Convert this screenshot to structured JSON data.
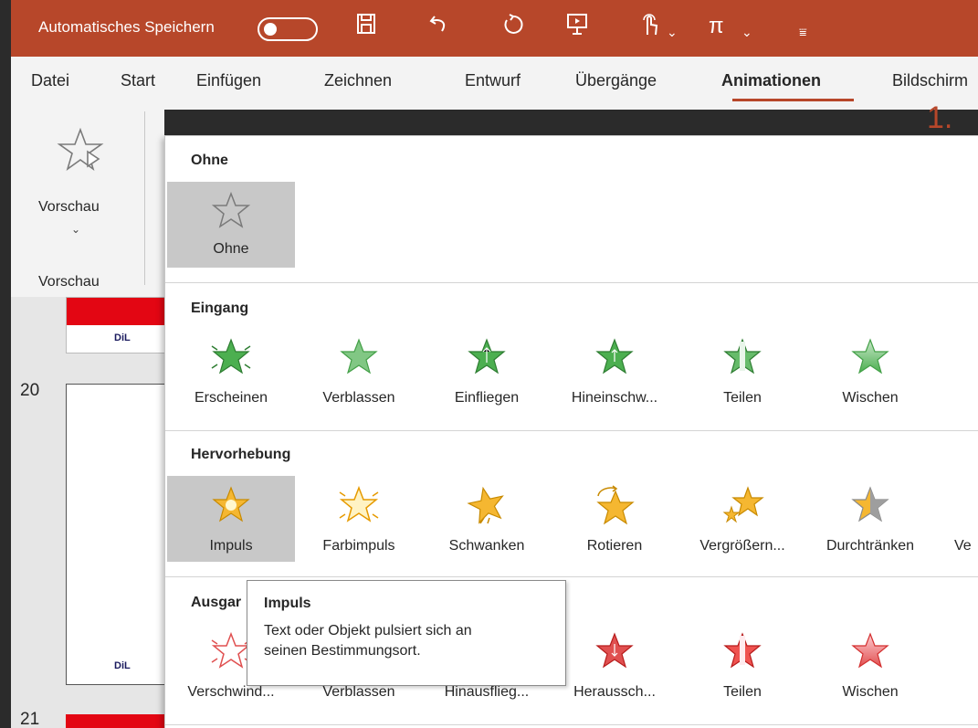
{
  "titlebar": {
    "autosave_label": "Automatisches Speichern",
    "icons": [
      "save-icon",
      "undo-icon",
      "redo-icon",
      "present-icon",
      "touch-mode-icon",
      "equation-icon",
      "customize-qat-icon"
    ]
  },
  "tabs": [
    "Datei",
    "Start",
    "Einfügen",
    "Zeichnen",
    "Entwurf",
    "Übergänge",
    "Animationen",
    "Bildschirm"
  ],
  "active_tab": "Animationen",
  "ribbon": {
    "preview_label": "Vorschau",
    "group_label": "Vorschau"
  },
  "annotation": "1.",
  "slides": {
    "numbers": [
      "20",
      "21"
    ],
    "logo_text": "DiL"
  },
  "gallery": {
    "sections": {
      "none": {
        "title": "Ohne",
        "items": [
          "Ohne"
        ]
      },
      "entrance": {
        "title": "Eingang",
        "items": [
          "Erscheinen",
          "Verblassen",
          "Einfliegen",
          "Hineinschw...",
          "Teilen",
          "Wischen"
        ]
      },
      "emphasis": {
        "title": "Hervorhebung",
        "items": [
          "Impuls",
          "Farbimpuls",
          "Schwanken",
          "Rotieren",
          "Vergrößern...",
          "Durchtränken",
          "Ve"
        ]
      },
      "exit": {
        "title": "Ausgar",
        "items": [
          "Verschwind...",
          "Verblassen",
          "Hinausflieg...",
          "Heraussch...",
          "Teilen",
          "Wischen"
        ]
      }
    },
    "selected_item": "Impuls"
  },
  "tooltip": {
    "title": "Impuls",
    "line1": "Text oder Objekt pulsiert sich an",
    "line2": "seinen Bestimmungsort."
  },
  "colors": {
    "accent": "#b7472a",
    "entrance_green": "#4caf50",
    "emphasis_gold": "#f5b731",
    "exit_red": "#e05050",
    "selection_gray": "#c8c8c8"
  }
}
